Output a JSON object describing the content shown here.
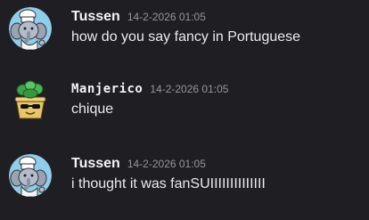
{
  "messages": [
    {
      "username": "Tussen",
      "timestamp": "14-2-2026 01:05",
      "text": "how do you say fancy in Portuguese",
      "avatar_icon": "chef-elephant-icon"
    },
    {
      "username": "Manjerico",
      "timestamp": "14-2-2026 01:05",
      "text": "chique",
      "avatar_icon": "basil-plant-icon"
    },
    {
      "username": "Tussen",
      "timestamp": "14-2-2026 01:05",
      "text": "i thought it was fanSUIIIIIIIIIIIIII",
      "avatar_icon": "chef-elephant-icon"
    }
  ],
  "colors": {
    "background": "#1f1f23",
    "username": "#f2f3f5",
    "timestamp": "#94959c",
    "text": "#eaeaef"
  }
}
